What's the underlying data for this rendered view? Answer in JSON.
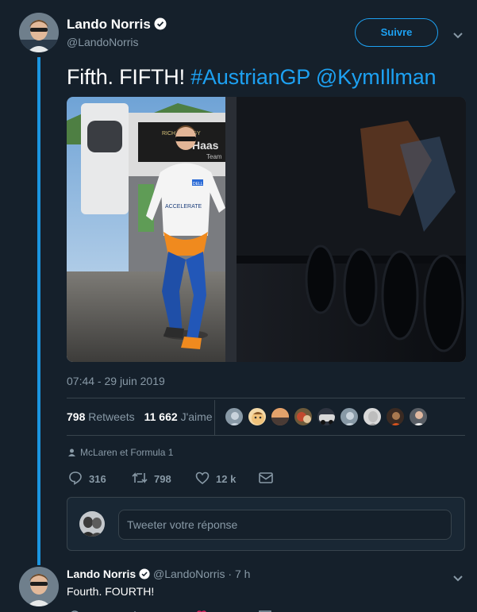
{
  "tweet": {
    "author_name": "Lando Norris",
    "author_handle": "@LandoNorris",
    "follow_label": "Suivre",
    "text_plain": "Fifth. FIFTH! ",
    "hashtag": "#AustrianGP",
    "mention": "@KymIllman",
    "photo_alt": "Lando Norris running in the paddock",
    "photo_signage": [
      "RICH ENERGY",
      "Haas",
      "Team",
      "ACCELERATE",
      "DELL"
    ],
    "timestamp": "07:44 - 29 juin 2019",
    "retweets_count": "798",
    "retweets_label": "Retweets",
    "likes_count": "11 662",
    "likes_label": "J'aime",
    "liker_count": 9,
    "context": "McLaren et Formula 1",
    "replies": "316",
    "retweets_action": "798",
    "likes_action": "12 k"
  },
  "reply": {
    "placeholder": "Tweeter votre réponse"
  },
  "next_tweet": {
    "author_name": "Lando Norris",
    "author_handle": "@LandoNorris",
    "time": "· 7 h",
    "text": "Fourth. FOURTH!"
  },
  "colors": {
    "background": "#15202b",
    "accent": "#1da1f2",
    "thread_line": "#1b95e0",
    "muted": "#8899a6",
    "border": "#38444d"
  },
  "icons": [
    "verified-icon",
    "chevron-down-icon",
    "person-icon",
    "reply-icon",
    "retweet-icon",
    "like-icon",
    "message-icon"
  ]
}
